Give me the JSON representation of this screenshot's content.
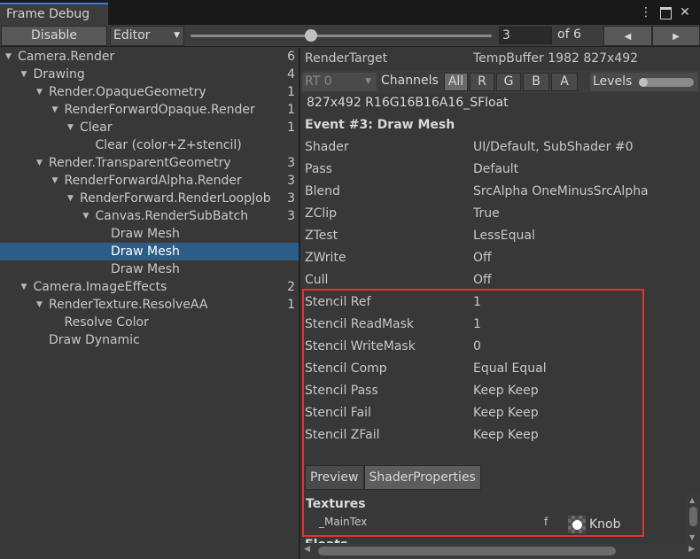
{
  "window": {
    "tab_title": "Frame Debug",
    "menu_icon": "kebab-menu-icon",
    "maximize_icon": "maximize-icon",
    "close_icon": "close-icon",
    "menu_glyph": "⋮",
    "close_glyph": "✕"
  },
  "toolbar": {
    "disable_label": "Disable",
    "target_dropdown_value": "Editor",
    "event_index": "3",
    "event_total_label": "of 6",
    "prev_glyph": "◀",
    "next_glyph": "▶",
    "slider_value": 3,
    "slider_max": 6
  },
  "tree": {
    "rows": [
      {
        "label": "Camera.Render",
        "count": "6",
        "expanded": true
      },
      {
        "label": "Drawing",
        "count": "4",
        "expanded": true
      },
      {
        "label": "Render.OpaqueGeometry",
        "count": "1",
        "expanded": true
      },
      {
        "label": "RenderForwardOpaque.Render",
        "count": "1",
        "expanded": true
      },
      {
        "label": "Clear",
        "count": "1",
        "expanded": true
      },
      {
        "label": "Clear (color+Z+stencil)",
        "count": ""
      },
      {
        "label": "Render.TransparentGeometry",
        "count": "3",
        "expanded": true
      },
      {
        "label": "RenderForwardAlpha.Render",
        "count": "3",
        "expanded": true
      },
      {
        "label": "RenderForward.RenderLoopJob",
        "count": "3",
        "expanded": true
      },
      {
        "label": "Canvas.RenderSubBatch",
        "count": "3",
        "expanded": true
      },
      {
        "label": "Draw Mesh",
        "count": ""
      },
      {
        "label": "Draw Mesh",
        "count": "",
        "selected": true
      },
      {
        "label": "Draw Mesh",
        "count": ""
      },
      {
        "label": "Camera.ImageEffects",
        "count": "2",
        "expanded": true
      },
      {
        "label": "RenderTexture.ResolveAA",
        "count": "1",
        "expanded": true
      },
      {
        "label": "Resolve Color",
        "count": ""
      },
      {
        "label": "Draw Dynamic",
        "count": ""
      }
    ]
  },
  "render_target": {
    "label": "RenderTarget",
    "value": "TempBuffer 1982 827x492",
    "rt_dropdown": "RT 0",
    "channels_label": "Channels",
    "channels": [
      "All",
      "R",
      "G",
      "B",
      "A"
    ],
    "levels_label": "Levels",
    "format": "827x492 R16G16B16A16_SFloat"
  },
  "event": {
    "title": "Event #3: Draw Mesh",
    "properties": [
      {
        "key": "Shader",
        "value": "UI/Default, SubShader #0"
      },
      {
        "key": "Pass",
        "value": "Default"
      },
      {
        "key": "Blend",
        "value": "SrcAlpha OneMinusSrcAlpha"
      },
      {
        "key": "ZClip",
        "value": "True"
      },
      {
        "key": "ZTest",
        "value": "LessEqual"
      },
      {
        "key": "ZWrite",
        "value": "Off"
      },
      {
        "key": "Cull",
        "value": "Off"
      },
      {
        "key": "Stencil Ref",
        "value": "1"
      },
      {
        "key": "Stencil ReadMask",
        "value": "1"
      },
      {
        "key": "Stencil WriteMask",
        "value": "0"
      },
      {
        "key": "Stencil Comp",
        "value": "Equal Equal"
      },
      {
        "key": "Stencil Pass",
        "value": "Keep Keep"
      },
      {
        "key": "Stencil Fail",
        "value": "Keep Keep"
      },
      {
        "key": "Stencil ZFail",
        "value": "Keep Keep"
      }
    ]
  },
  "tabs": [
    "Preview",
    "ShaderProperties"
  ],
  "textures": {
    "header": "Textures",
    "name": "_MainTex",
    "flag": "f",
    "value": "Knob",
    "cut_off_header": "Floats"
  },
  "colors": {
    "selection": "#2c5d87",
    "highlight_box": "#e8302a",
    "accent_tab": "#3a7bd5"
  }
}
